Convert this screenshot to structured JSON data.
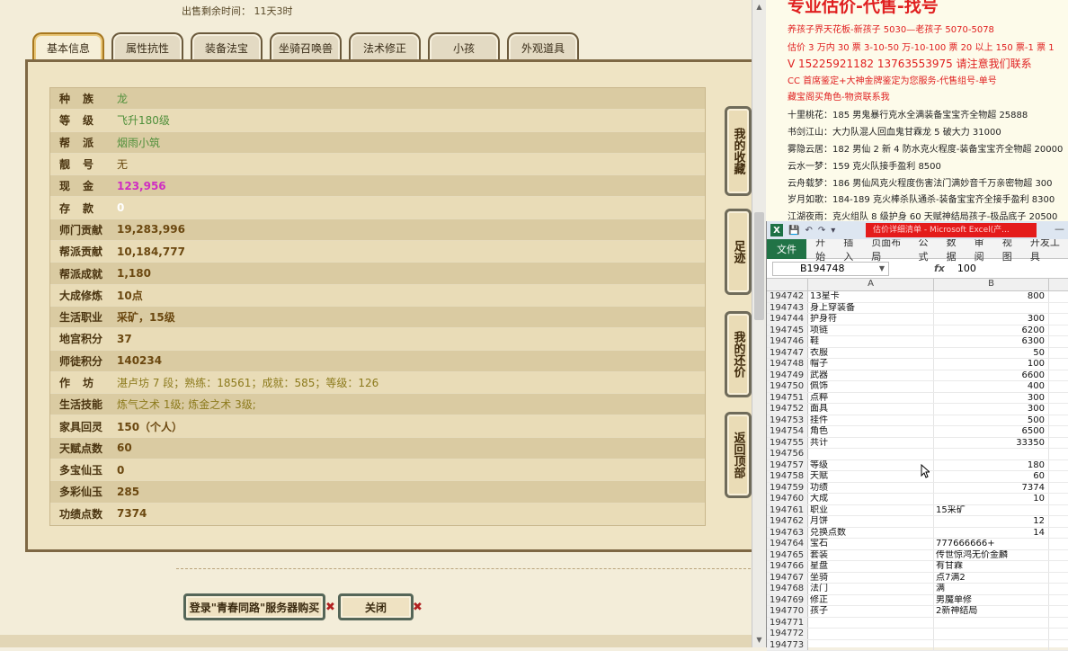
{
  "game": {
    "sale_time_label": "出售剩余时间：",
    "sale_time_value": "11天3时",
    "tabs": [
      "基本信息",
      "属性抗性",
      "装备法宝",
      "坐骑召唤兽",
      "法术修正",
      "小孩",
      "外观道具"
    ],
    "active_tab": 0,
    "rows": [
      {
        "label": "种族",
        "value": "龙",
        "style": "green",
        "spread": true
      },
      {
        "label": "等级",
        "value": "飞升180级",
        "style": "green",
        "spread": true
      },
      {
        "label": "帮派",
        "value": "烟雨小筑",
        "style": "green",
        "spread": true
      },
      {
        "label": "靓号",
        "value": "无",
        "style": "plain",
        "spread": true
      },
      {
        "label": "现金",
        "value": "123,956",
        "style": "pink",
        "spread": true
      },
      {
        "label": "存款",
        "value": "0",
        "style": "white",
        "spread": true
      },
      {
        "label": "师门贡献",
        "value": "19,283,996",
        "style": "brown"
      },
      {
        "label": "帮派贡献",
        "value": "10,184,777",
        "style": "brown"
      },
      {
        "label": "帮派成就",
        "value": "1,180",
        "style": "brown"
      },
      {
        "label": "大成修炼",
        "value": "10点",
        "style": "brown"
      },
      {
        "label": "生活职业",
        "value": "采矿，15级",
        "style": "brown"
      },
      {
        "label": "地宫积分",
        "value": "37",
        "style": "brown"
      },
      {
        "label": "师徒积分",
        "value": "140234",
        "style": "brown"
      },
      {
        "label": "作坊",
        "value": "湛卢坊 7 段；熟练：18561；成就：585；等级：126",
        "style": "olive",
        "spread": true
      },
      {
        "label": "生活技能",
        "value": "炼气之术 1级; 炼金之术 3级;",
        "style": "olive"
      },
      {
        "label": "家具回灵",
        "value": "150（个人）",
        "style": "brown"
      },
      {
        "label": "天赋点数",
        "value": "60",
        "style": "brown"
      },
      {
        "label": "多宝仙玉",
        "value": "0",
        "style": "brown"
      },
      {
        "label": "多彩仙玉",
        "value": "285",
        "style": "brown"
      },
      {
        "label": "功绩点数",
        "value": "7374",
        "style": "brown"
      }
    ],
    "side_buttons": [
      "我的收藏",
      "足迹",
      "我的还价",
      "返回顶部"
    ],
    "buy_button": "登录\"青春同路\"服务器购买",
    "close_button": "关闭"
  },
  "ad": {
    "title": "专业估价-代售-找号",
    "lines": [
      "养孩子界天花板-新孩子 5030—老孩子 5070-5078",
      "估价 3 万内 30 票 3-10-50 万-10-100 票 20 以上 150 票-1 票 1",
      "V 15225921182     13763553975   请注意我们联系",
      "CC 首席鉴定+大神金牌鉴定为您服务-代售组号-单号",
      "藏宝阁买角色-物资联系我",
      "十里桃花：185 男鬼暴行克水全满装备宝宝齐全物超 25888",
      "书剑江山：大力队混人回血鬼甘霖龙 5 破大力 31000",
      "雾隐云居：182 男仙 2 新 4 防水克火程度-装备宝宝齐全物超 20000",
      "云水一梦：159 克火队接手盈利 8500",
      "云舟载梦：186 男仙风克火程度伤害法门满妙音千万亲密物超 300",
      "岁月如歌：184-189 克火棒杀队通杀-装备宝宝齐全接手盈利 8300",
      "江湖夜雨：克火组队 8 级护身 60 天赋神结局孩子-极品底子 20500"
    ]
  },
  "excel": {
    "doc_title": "估价详细清单 - Microsoft Excel(产...",
    "tabs": [
      "文件",
      "开始",
      "插入",
      "页面布局",
      "公式",
      "数据",
      "审阅",
      "视图",
      "开发工具"
    ],
    "name_box": "B194748",
    "fx": "fx",
    "formula_value": "100",
    "col_a": "A",
    "col_b": "B",
    "rows": [
      {
        "n": "194742",
        "a": "13星卡",
        "b": "800"
      },
      {
        "n": "194743",
        "a": "身上穿装备",
        "b": ""
      },
      {
        "n": "194744",
        "a": "护身符",
        "b": "300"
      },
      {
        "n": "194745",
        "a": "项链",
        "b": "6200"
      },
      {
        "n": "194746",
        "a": "鞋",
        "b": "6300"
      },
      {
        "n": "194747",
        "a": "衣服",
        "b": "50"
      },
      {
        "n": "194748",
        "a": "帽子",
        "b": "100"
      },
      {
        "n": "194749",
        "a": "武器",
        "b": "6600"
      },
      {
        "n": "194750",
        "a": "佩饰",
        "b": "400"
      },
      {
        "n": "194751",
        "a": "点粹",
        "b": "300"
      },
      {
        "n": "194752",
        "a": "面具",
        "b": "300"
      },
      {
        "n": "194753",
        "a": "挂件",
        "b": "500"
      },
      {
        "n": "194754",
        "a": "角色",
        "b": "6500"
      },
      {
        "n": "194755",
        "a": "共计",
        "b": "33350"
      },
      {
        "n": "194756",
        "a": "",
        "b": ""
      },
      {
        "n": "194757",
        "a": "等级",
        "b": "180"
      },
      {
        "n": "194758",
        "a": "天赋",
        "b": "60"
      },
      {
        "n": "194759",
        "a": "功绩",
        "b": "7374"
      },
      {
        "n": "194760",
        "a": "大成",
        "b": "10"
      },
      {
        "n": "194761",
        "a": "职业",
        "b": "15采矿",
        "t": true
      },
      {
        "n": "194762",
        "a": "月饼",
        "b": "12"
      },
      {
        "n": "194763",
        "a": "兑换点数",
        "b": "14"
      },
      {
        "n": "194764",
        "a": "宝石",
        "b": "777666666+",
        "t": true
      },
      {
        "n": "194765",
        "a": "套装",
        "b": "传世惊鸿无价金麟",
        "t": true
      },
      {
        "n": "194766",
        "a": "星盘",
        "b": "有甘霖",
        "t": true
      },
      {
        "n": "194767",
        "a": "坐骑",
        "b": "点7满2",
        "t": true
      },
      {
        "n": "194768",
        "a": "法门",
        "b": "满",
        "t": true
      },
      {
        "n": "194769",
        "a": "修正",
        "b": "男魔单修",
        "t": true
      },
      {
        "n": "194770",
        "a": "孩子",
        "b": "2新神结局",
        "t": true
      },
      {
        "n": "194771",
        "a": "",
        "b": ""
      },
      {
        "n": "194772",
        "a": "",
        "b": ""
      },
      {
        "n": "194773",
        "a": "",
        "b": ""
      }
    ]
  }
}
